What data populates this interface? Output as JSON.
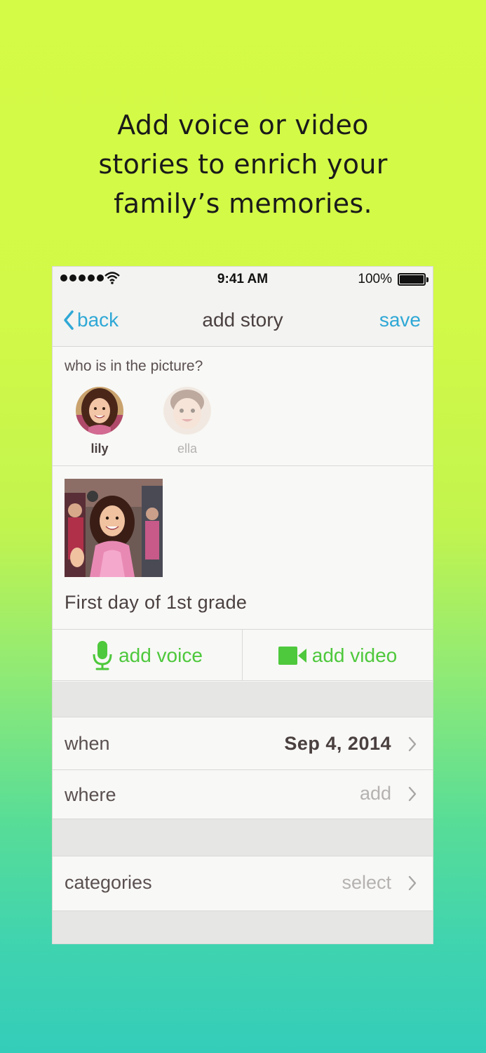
{
  "headline": {
    "line1": "Add voice or video",
    "line2": "stories to enrich your",
    "line3": "family’s memories."
  },
  "status_bar": {
    "time": "9:41 AM",
    "battery_label": "100%",
    "icons": [
      "signal-dots-icon",
      "wifi-icon",
      "battery-icon"
    ]
  },
  "nav": {
    "back_label": "back",
    "title": "add story",
    "save_label": "save",
    "back_icon": "chevron-left-icon"
  },
  "people": {
    "question": "who is in the picture?",
    "items": [
      {
        "name": "lily",
        "selected": true
      },
      {
        "name": "ella",
        "selected": false
      }
    ]
  },
  "story": {
    "title": "First day of 1st grade"
  },
  "media": {
    "voice_label": "add voice",
    "voice_icon": "microphone-icon",
    "video_label": "add video",
    "video_icon": "video-camera-icon"
  },
  "details": {
    "when_label": "when",
    "when_value": "Sep 4, 2014",
    "where_label": "where",
    "where_value": "add",
    "categories_label": "categories",
    "categories_value": "select"
  },
  "colors": {
    "accent_blue": "#2fa8d6",
    "accent_green": "#4ec83c",
    "bg_top": "#d4fb45",
    "bg_bottom": "#34cdb9"
  }
}
